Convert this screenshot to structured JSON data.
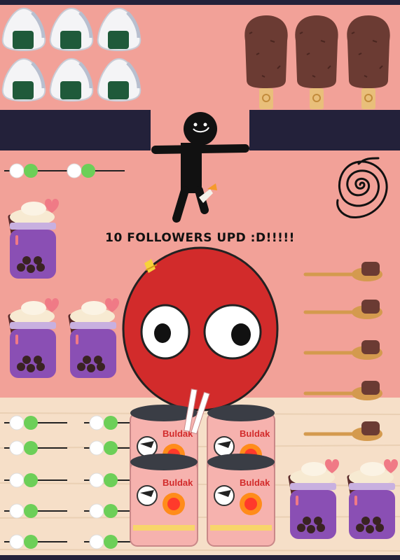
{
  "caption": "10 FOLLOWERS UPD :D!!!!!",
  "colors": {
    "wall": "#f2a198",
    "floor": "#f6dfc8",
    "frame": "#23213a",
    "shelf": "#23213a",
    "boba_tea": "#8a4fb4",
    "red_ball": "#d22b2b"
  },
  "icons": [
    "onigiri-icon",
    "ice-cream-bar-icon",
    "stick-figure-icon",
    "spiral-icon",
    "dango-skewer-icon",
    "boba-tea-jar-icon",
    "red-ball-character-icon",
    "spoon-icon",
    "buldak-ramen-icon"
  ]
}
